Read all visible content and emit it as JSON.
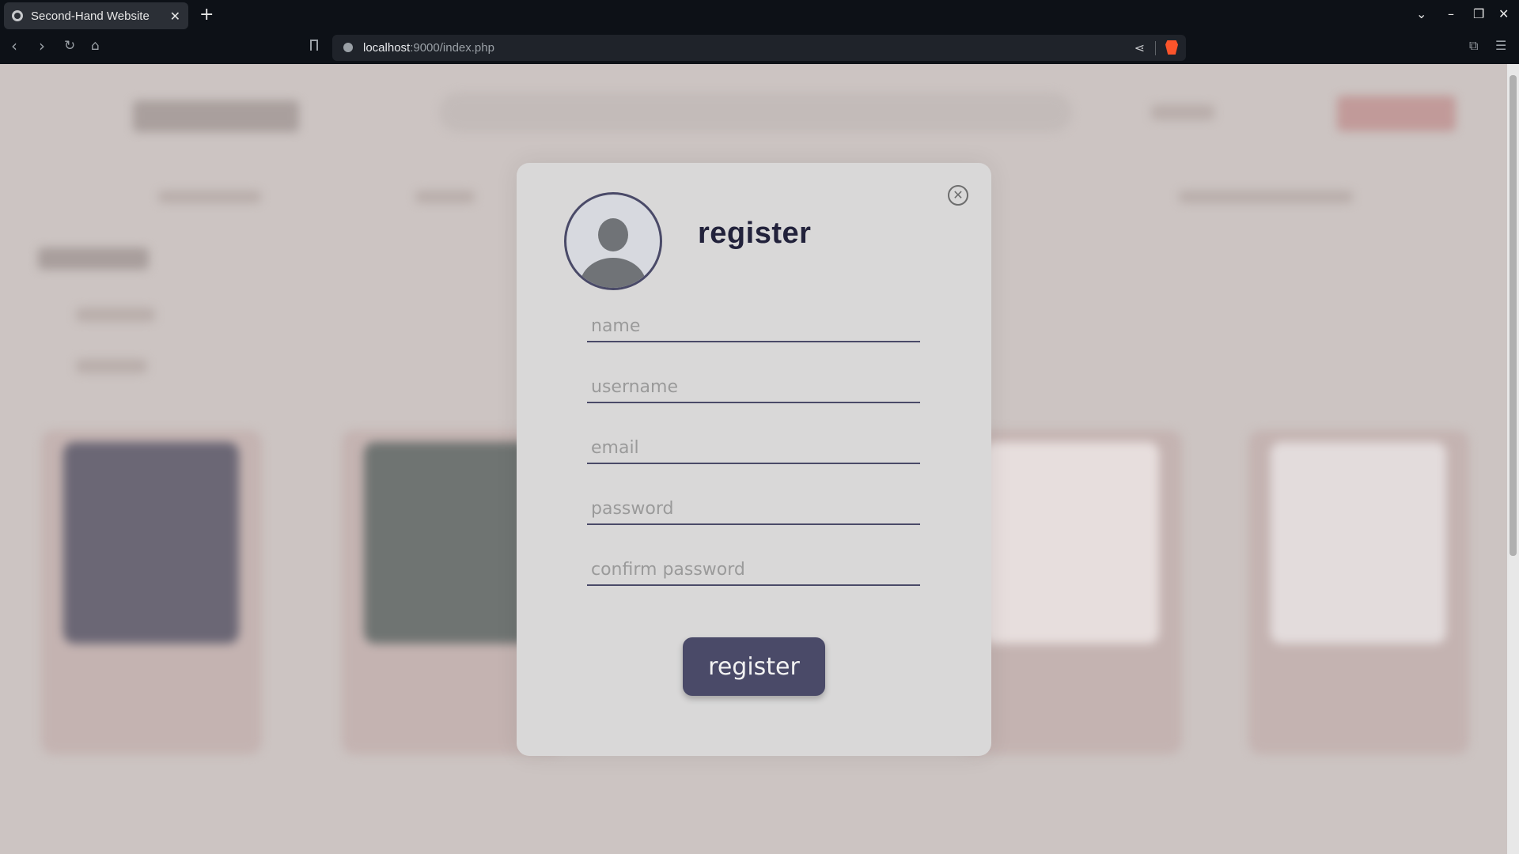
{
  "browser": {
    "tab_title": "Second-Hand Website",
    "tab_close": "✕",
    "new_tab": "+",
    "url_host": "localhost",
    "url_rest": ":9000/index.php",
    "icons": [
      "globe-icon",
      "close-icon",
      "plus-icon",
      "back-icon",
      "forward-icon",
      "reload-icon",
      "home-icon",
      "bookmark-icon",
      "info-icon",
      "share-icon",
      "brave-shield-icon",
      "extensions-icon",
      "menu-icon"
    ]
  },
  "modal": {
    "title": "register",
    "close_symbol": "✕",
    "fields": {
      "name_placeholder": "name",
      "username_placeholder": "username",
      "email_placeholder": "email",
      "password_placeholder": "password",
      "confirm_placeholder": "confirm password"
    },
    "submit_label": "register"
  },
  "colors": {
    "accent": "#4a4a68",
    "modal_bg": "#d9d8d8",
    "page_bg": "#ccc4c2",
    "chrome_bg": "#0d1117"
  }
}
